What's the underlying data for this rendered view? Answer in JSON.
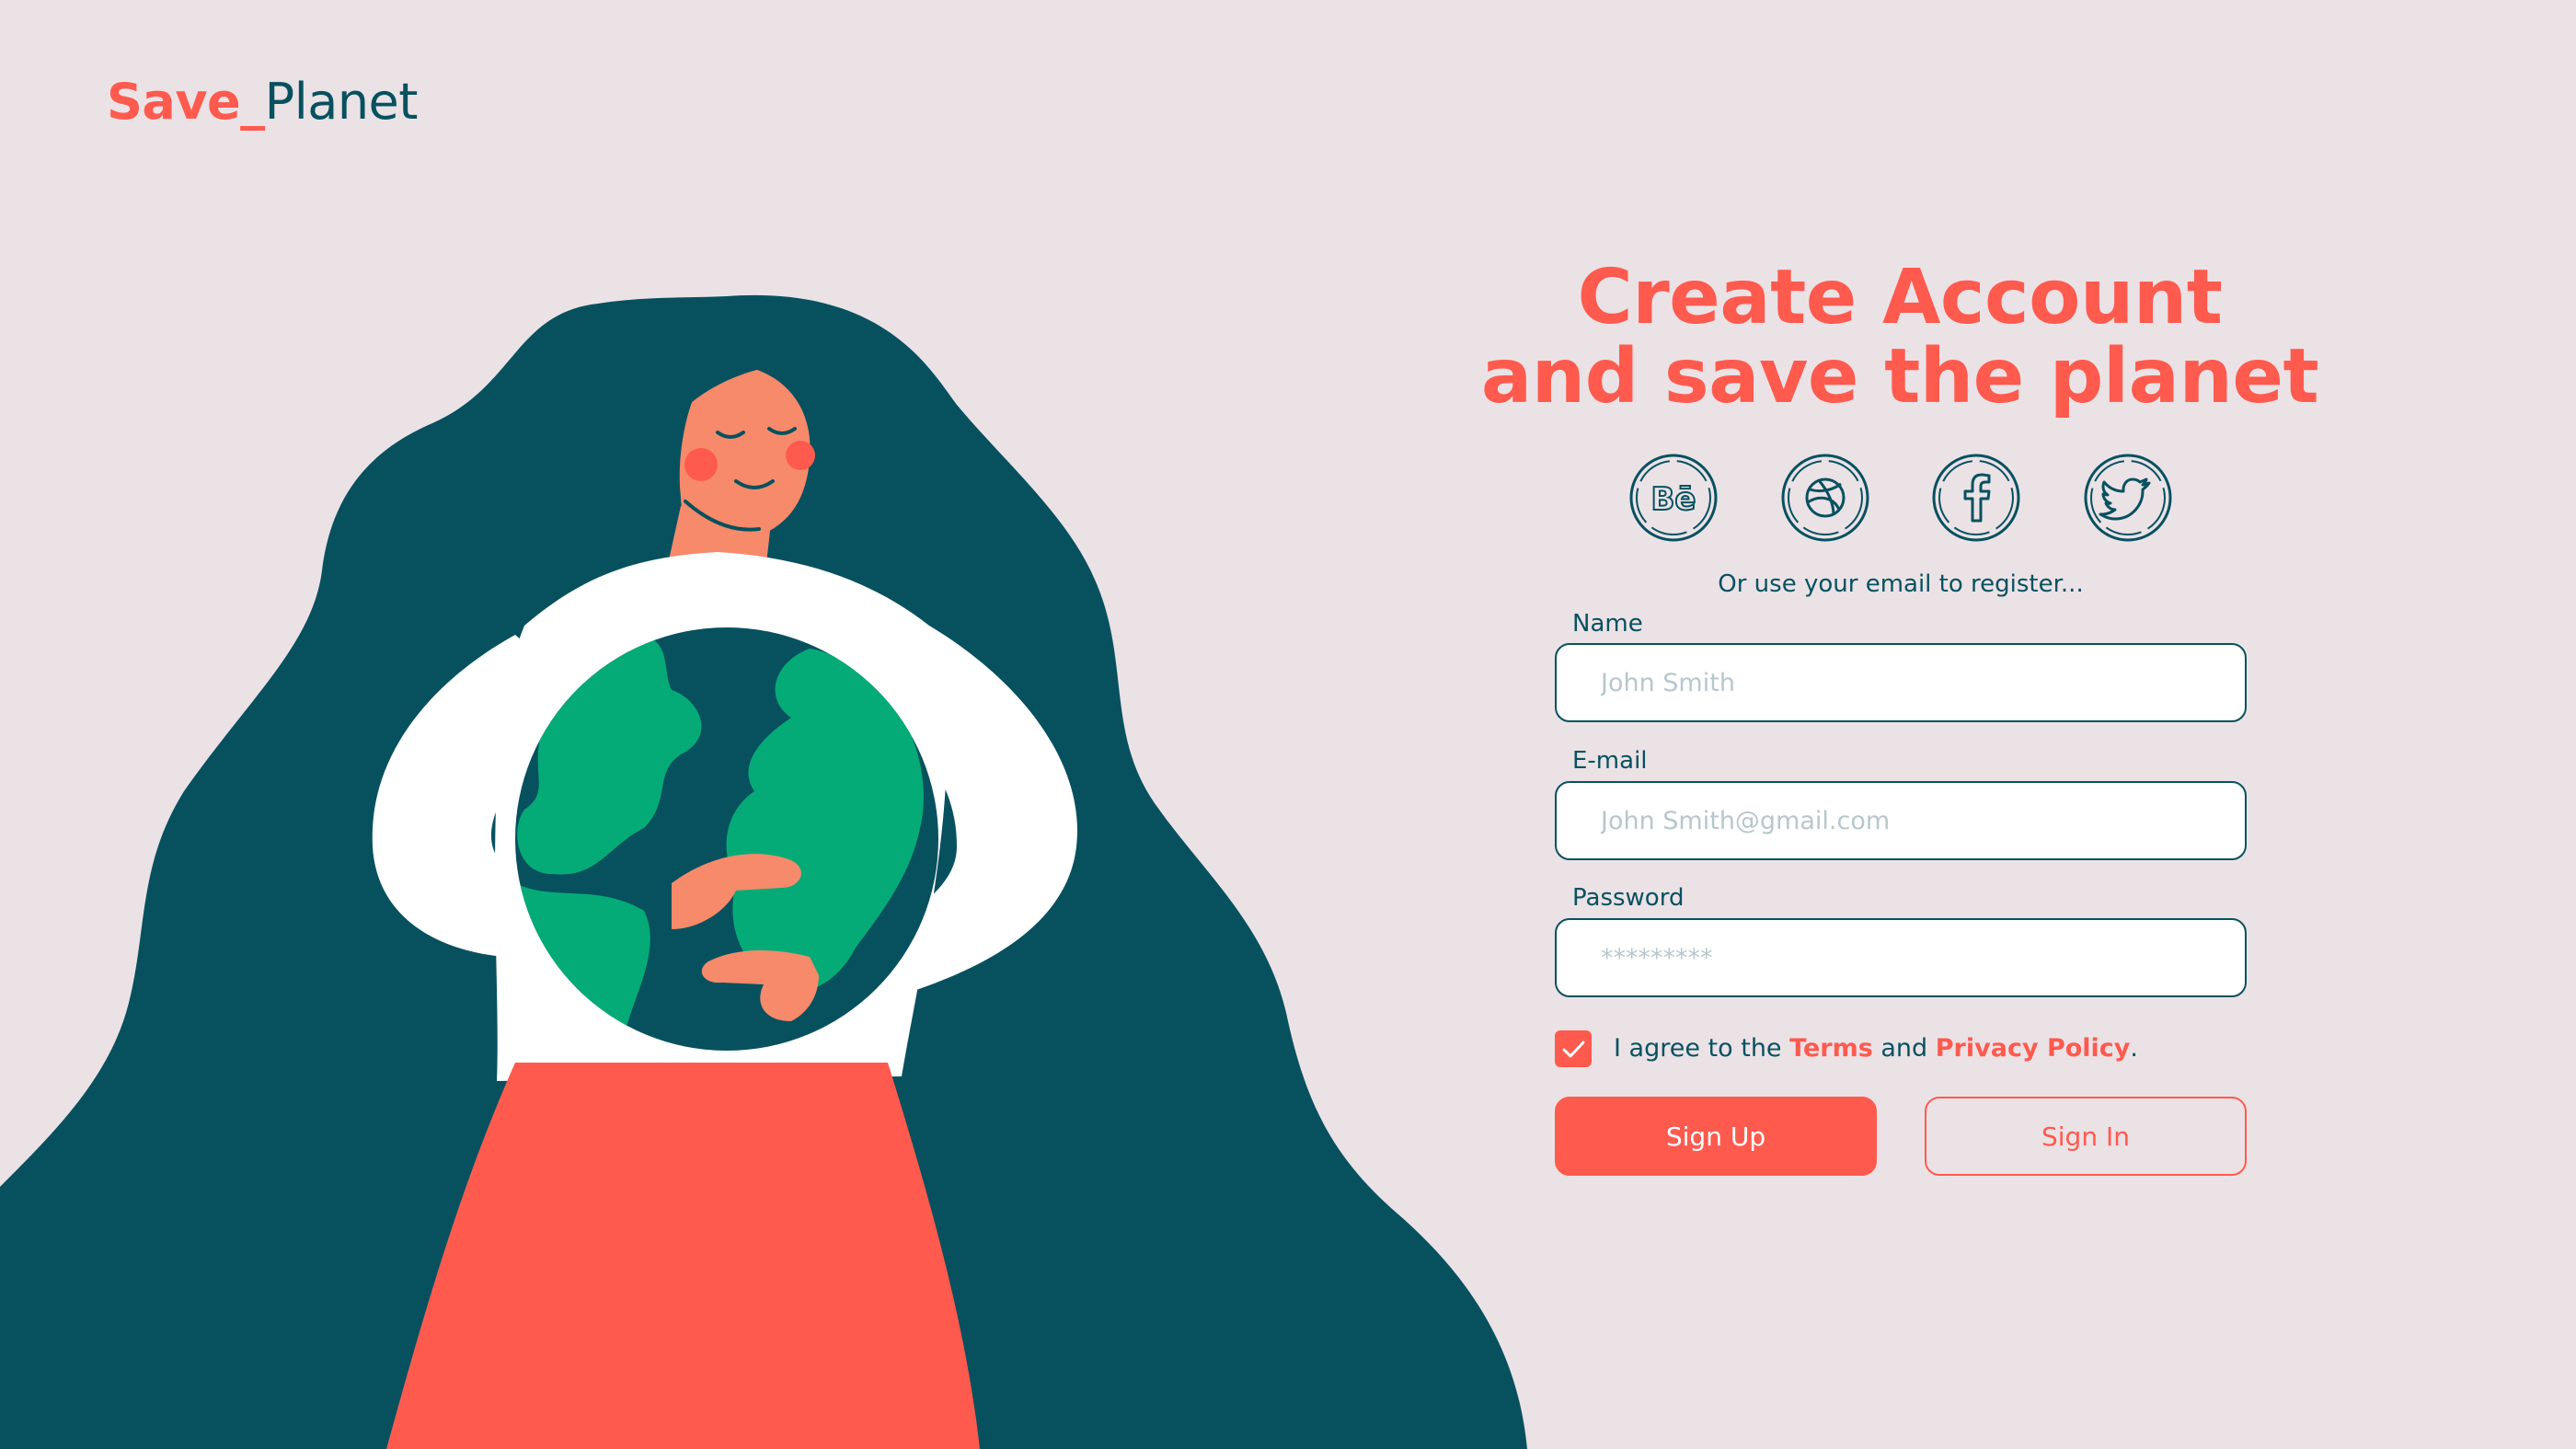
{
  "brand": {
    "logo_part1": "Save_",
    "logo_part2": "Planet"
  },
  "hero": {
    "headline_line1": "Create Account",
    "headline_line2": "and save the planet"
  },
  "social_icons": [
    {
      "icon": "behance-icon"
    },
    {
      "icon": "dribbble-icon"
    },
    {
      "icon": "facebook-icon"
    },
    {
      "icon": "twitter-icon"
    }
  ],
  "form": {
    "alt_text": "Or use your email to register...",
    "name": {
      "label": "Name",
      "placeholder": "John Smith",
      "value": ""
    },
    "email": {
      "label": "E-mail",
      "placeholder": "John Smith@gmail.com",
      "value": ""
    },
    "password": {
      "label": "Password",
      "placeholder": "*********",
      "value": ""
    },
    "agree": {
      "checked": true,
      "prefix": "I agree to the ",
      "terms": "Terms",
      "middle": " and ",
      "privacy": "Privacy Policy",
      "suffix": "."
    },
    "signup_label": "Sign Up",
    "signin_label": "Sign In"
  },
  "colors": {
    "background": "#ebe2e6",
    "accent": "#ff5a4e",
    "teal": "#07515f",
    "globe_land": "#05ab77",
    "white": "#ffffff"
  }
}
